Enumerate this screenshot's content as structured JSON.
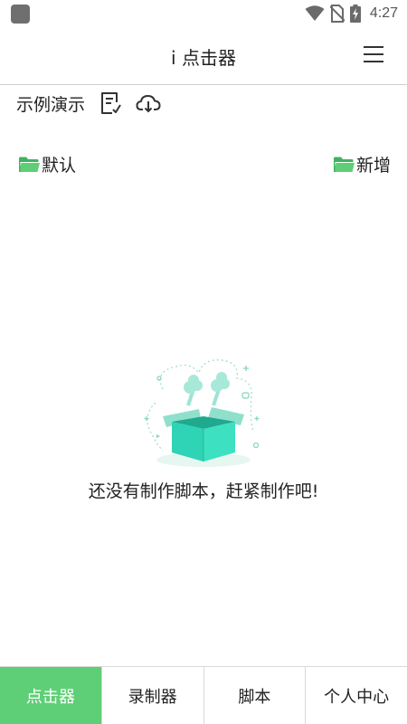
{
  "status_bar": {
    "time": "4:27"
  },
  "app_bar": {
    "title": "i 点击器"
  },
  "toolbar": {
    "demo_label": "示例演示"
  },
  "folders": {
    "default_label": "默认",
    "new_label": "新增"
  },
  "empty_state": {
    "message": "还没有制作脚本，赶紧制作吧!"
  },
  "tabs": [
    {
      "label": "点击器",
      "active": true
    },
    {
      "label": "录制器",
      "active": false
    },
    {
      "label": "脚本",
      "active": false
    },
    {
      "label": "个人中心",
      "active": false
    }
  ],
  "colors": {
    "accent": "#5ecf76",
    "folder": "#4cc56a",
    "box": "#2fd3b5"
  }
}
